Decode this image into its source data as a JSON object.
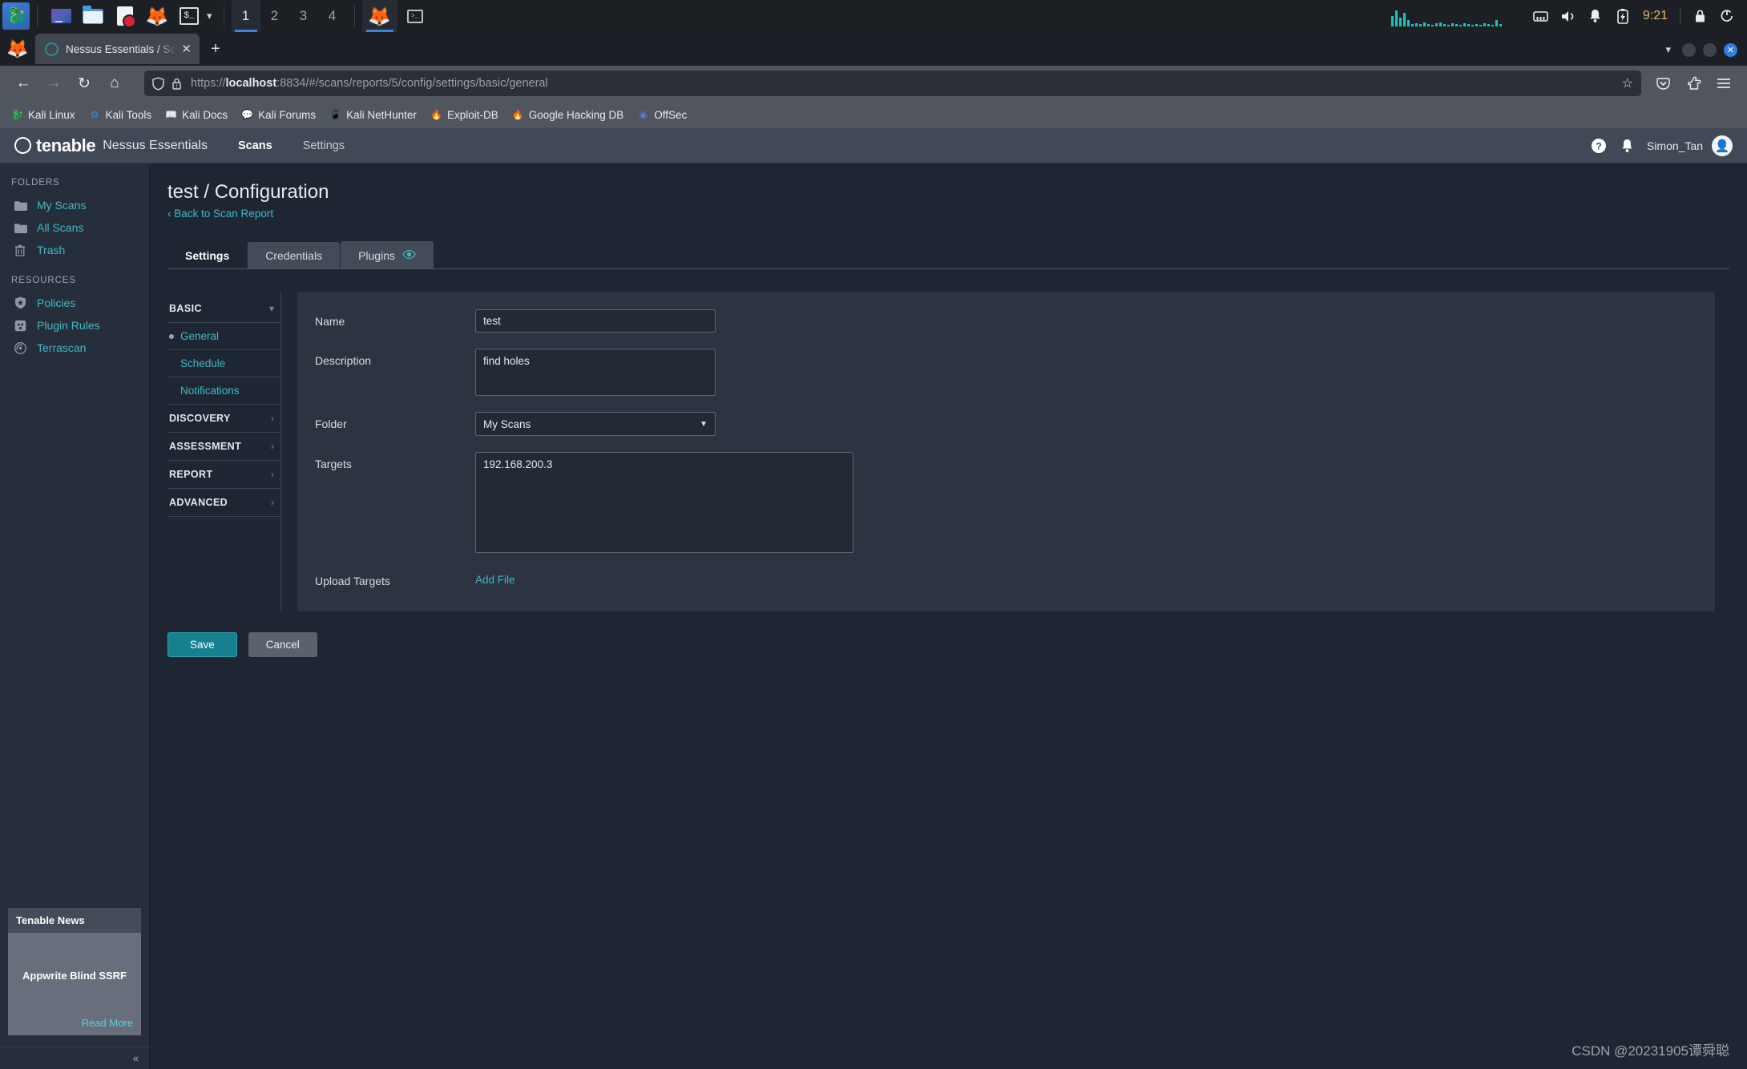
{
  "taskbar": {
    "kali_icon": "kali-dragon-icon",
    "launchers": [
      {
        "name": "virtualbox-icon",
        "label": "VirtualBox"
      },
      {
        "name": "files-icon",
        "label": "Files"
      },
      {
        "name": "text-editor-icon",
        "label": "Editor"
      },
      {
        "name": "firefox-icon",
        "label": "Firefox"
      },
      {
        "name": "terminal-icon",
        "label": "Terminal"
      }
    ],
    "workspaces": [
      "1",
      "2",
      "3",
      "4"
    ],
    "active_workspace": "1",
    "open_apps": [
      {
        "name": "firefox-window-icon",
        "label": "Firefox",
        "selected": true
      },
      {
        "name": "terminal-window-icon",
        "label": "Terminal",
        "selected": false
      }
    ],
    "tray": {
      "network_icon": "ethernet-icon",
      "volume_icon": "speaker-icon",
      "notifications_icon": "bell-icon",
      "battery_icon": "battery-charging-icon",
      "clock": "9:21",
      "lock_icon": "lock-icon",
      "logout_icon": "power-logout-icon",
      "graph_color": "#17c7bd"
    }
  },
  "browser": {
    "tab": {
      "title": "Nessus Essentials / Scans",
      "favicon": "tenable-favicon",
      "close_icon": "close-icon"
    },
    "new_tab_label": "+",
    "tab_list_caret": "chevron-down-icon",
    "window_controls": [
      "minimize",
      "maximize",
      "close"
    ],
    "nav": {
      "back_icon": "arrow-left-icon",
      "forward_icon": "arrow-right-icon",
      "reload_icon": "reload-icon",
      "home_icon": "home-icon",
      "shield_icon": "shield-icon",
      "lock_warning_icon": "lock-warning-icon",
      "bookmark_star_icon": "star-icon",
      "pocket_icon": "pocket-icon",
      "extension_icon": "extension-icon",
      "menu_icon": "hamburger-menu-icon"
    },
    "url": {
      "scheme": "https://",
      "host": "localhost",
      "rest": ":8834/#/scans/reports/5/config/settings/basic/general",
      "full": "https://localhost:8834/#/scans/reports/5/config/settings/basic/general"
    },
    "bookmarks": [
      {
        "label": "Kali Linux",
        "icon": "kali-dragon-icon"
      },
      {
        "label": "Kali Tools",
        "icon": "kali-tools-icon"
      },
      {
        "label": "Kali Docs",
        "icon": "kali-docs-icon"
      },
      {
        "label": "Kali Forums",
        "icon": "kali-forums-icon"
      },
      {
        "label": "Kali NetHunter",
        "icon": "kali-nethunter-icon"
      },
      {
        "label": "Exploit-DB",
        "icon": "exploit-db-icon"
      },
      {
        "label": "Google Hacking DB",
        "icon": "google-hacking-db-icon"
      },
      {
        "label": "OffSec",
        "icon": "offsec-icon"
      }
    ]
  },
  "app": {
    "brand": "tenable",
    "product": "Nessus Essentials",
    "nav": [
      {
        "label": "Scans",
        "active": true
      },
      {
        "label": "Settings",
        "active": false
      }
    ],
    "header_icons": {
      "help": "help-circle-icon",
      "notifications": "bell-icon",
      "avatar": "user-avatar-icon"
    },
    "user": "Simon_Tan",
    "accent_color": "#41b7c4",
    "save_color": "#17808f"
  },
  "sidebar": {
    "sections": [
      {
        "title": "FOLDERS",
        "items": [
          {
            "label": "My Scans",
            "icon": "folder-icon"
          },
          {
            "label": "All Scans",
            "icon": "folder-icon"
          },
          {
            "label": "Trash",
            "icon": "trash-icon"
          }
        ]
      },
      {
        "title": "RESOURCES",
        "items": [
          {
            "label": "Policies",
            "icon": "shield-star-icon"
          },
          {
            "label": "Plugin Rules",
            "icon": "plugin-icon"
          },
          {
            "label": "Terrascan",
            "icon": "terrascan-icon"
          }
        ]
      }
    ],
    "news": {
      "header": "Tenable News",
      "title": "Appwrite Blind SSRF",
      "read_more": "Read More"
    },
    "collapse_icon": "collapse-double-chevron-icon"
  },
  "main": {
    "page_title": "test / Configuration",
    "back_link": "Back to Scan Report",
    "back_icon": "chevron-left-icon",
    "tabs": [
      {
        "label": "Settings",
        "active": true,
        "icon": null
      },
      {
        "label": "Credentials",
        "active": false,
        "icon": null
      },
      {
        "label": "Plugins",
        "active": false,
        "icon": "eye-icon"
      }
    ],
    "settings_nav": [
      {
        "type": "group",
        "label": "BASIC",
        "icon": "chevron-down-icon",
        "expanded": true
      },
      {
        "type": "sub",
        "label": "General",
        "selected": true
      },
      {
        "type": "sub",
        "label": "Schedule",
        "selected": false
      },
      {
        "type": "sub",
        "label": "Notifications",
        "selected": false
      },
      {
        "type": "group",
        "label": "DISCOVERY",
        "icon": "chevron-right-icon",
        "expanded": false
      },
      {
        "type": "group",
        "label": "ASSESSMENT",
        "icon": "chevron-right-icon",
        "expanded": false
      },
      {
        "type": "group",
        "label": "REPORT",
        "icon": "chevron-right-icon",
        "expanded": false
      },
      {
        "type": "group",
        "label": "ADVANCED",
        "icon": "chevron-right-icon",
        "expanded": false
      }
    ],
    "form": {
      "name_label": "Name",
      "name_value": "test",
      "description_label": "Description",
      "description_value": "find holes",
      "folder_label": "Folder",
      "folder_value": "My Scans",
      "folder_caret": "chevron-down-icon",
      "targets_label": "Targets",
      "targets_value": "192.168.200.3",
      "upload_targets_label": "Upload Targets",
      "add_file_label": "Add File"
    },
    "buttons": {
      "save": "Save",
      "cancel": "Cancel"
    }
  },
  "watermark": "CSDN @20231905谭舜聪"
}
